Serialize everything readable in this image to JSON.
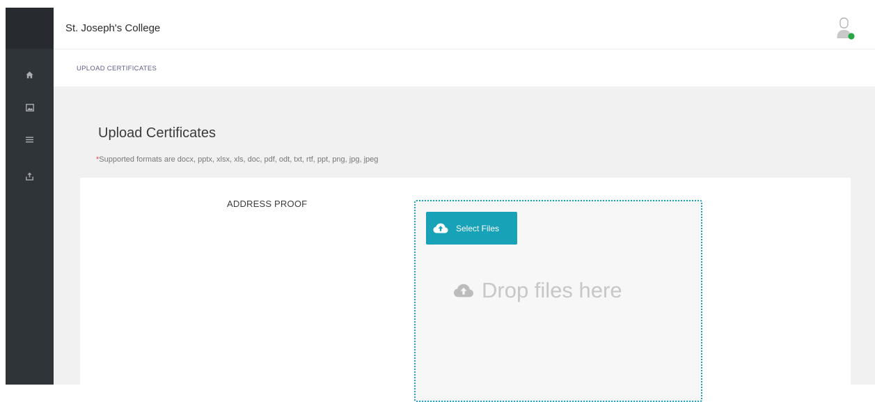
{
  "header": {
    "college_name": "St. Joseph's College",
    "avatar_icon": "user-avatar-icon",
    "online_status_color": "#28a745"
  },
  "sidebar": {
    "items": [
      {
        "icon": "home-icon",
        "label": "Home"
      },
      {
        "icon": "image-icon",
        "label": "Gallery"
      },
      {
        "icon": "menu-list-icon",
        "label": "List"
      },
      {
        "icon": "upload-icon",
        "label": "Upload"
      }
    ]
  },
  "breadcrumb": {
    "current": "UPLOAD CERTIFICATES"
  },
  "page": {
    "title": "Upload Certificates",
    "required_marker": "*",
    "formats_note": "Supported formats are docx, pptx, xlsx, xls, doc, pdf, odt, txt, rtf, ppt, png, jpg, jpeg"
  },
  "upload": {
    "field_label": "ADDRESS PROOF",
    "select_button_label": "Select Files",
    "select_button_icon": "cloud-upload-icon",
    "drop_hint": "Drop files here",
    "drop_hint_icon": "cloud-upload-icon",
    "accent_color": "#17a2b8"
  }
}
